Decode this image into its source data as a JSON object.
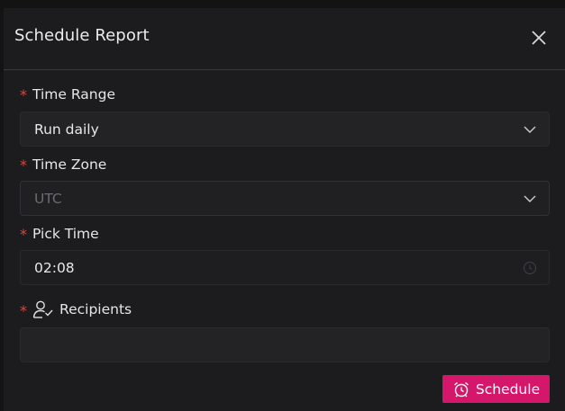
{
  "modal": {
    "title": "Schedule Report",
    "close_icon": "close-icon"
  },
  "fields": {
    "time_range": {
      "label": "Time Range",
      "value": "Run daily",
      "required_mark": "*"
    },
    "time_zone": {
      "label": "Time Zone",
      "value": "UTC",
      "required_mark": "*"
    },
    "pick_time": {
      "label": "Pick Time",
      "value": "02:08",
      "required_mark": "*"
    },
    "recipients": {
      "label": "Recipients",
      "value": "",
      "required_mark": "*",
      "icon": "user-check-icon"
    }
  },
  "actions": {
    "schedule_label": "Schedule",
    "schedule_icon": "alarm-clock-icon"
  },
  "colors": {
    "background": "#1c1c1e",
    "input": "#232326",
    "required": "#e0453c",
    "accent": "#d4176a"
  }
}
